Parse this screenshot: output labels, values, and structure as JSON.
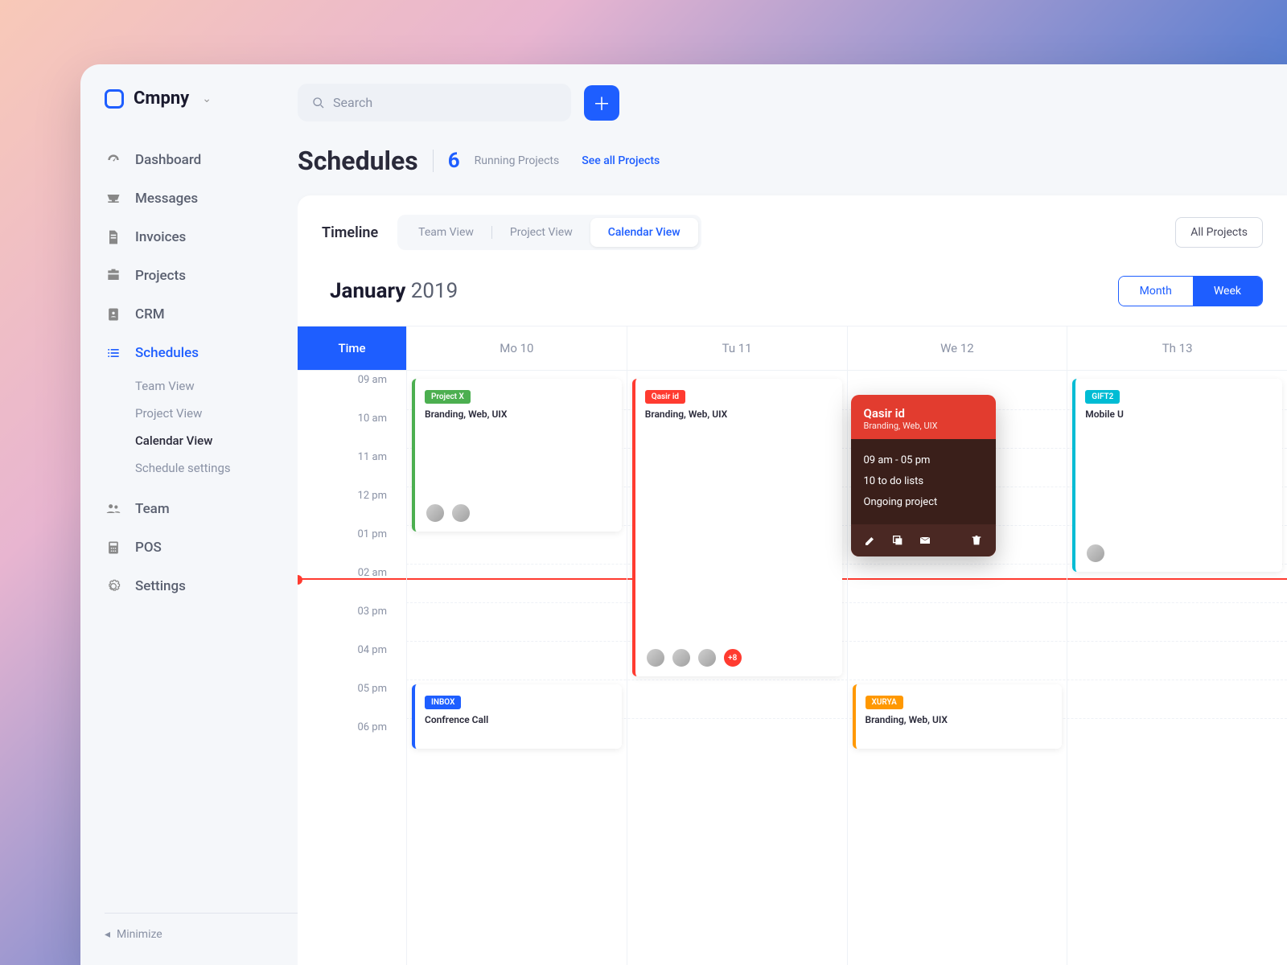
{
  "brand": "Cmpny",
  "search": {
    "placeholder": "Search"
  },
  "sidebar": {
    "items": [
      {
        "label": "Dashboard"
      },
      {
        "label": "Messages"
      },
      {
        "label": "Invoices"
      },
      {
        "label": "Projects"
      },
      {
        "label": "CRM"
      },
      {
        "label": "Schedules"
      },
      {
        "label": "Team"
      },
      {
        "label": "POS"
      },
      {
        "label": "Settings"
      }
    ],
    "sub": [
      {
        "label": "Team View"
      },
      {
        "label": "Project View"
      },
      {
        "label": "Calendar View"
      },
      {
        "label": "Schedule settings"
      }
    ],
    "minimize": "Minimize"
  },
  "header": {
    "title": "Schedules",
    "count": "6",
    "count_label": "Running Projects",
    "see_all": "See all Projects"
  },
  "panel": {
    "title": "Timeline",
    "tabs": [
      "Team View",
      "Project View",
      "Calendar View"
    ],
    "filter": "All Projects",
    "month": "January",
    "year": "2019",
    "range": [
      "Month",
      "Week"
    ]
  },
  "calendar": {
    "time_header": "Time",
    "days": [
      "Mo 10",
      "Tu 11",
      "We 12",
      "Th 13"
    ],
    "hours": [
      "09 am",
      "10 am",
      "11 am",
      "12 pm",
      "01 pm",
      "02 am",
      "03 pm",
      "04 pm",
      "05 pm",
      "06 pm"
    ]
  },
  "events": {
    "e1": {
      "tag": "Project X",
      "sub": "Branding, Web, UIX",
      "color": "#4caf50"
    },
    "e2": {
      "tag": "Qasir id",
      "sub": "Branding, Web, UIX",
      "color": "#ff3b30",
      "more": "+8"
    },
    "e3": {
      "tag": "GIFT2",
      "sub": "Mobile U",
      "color": "#00bcd4"
    },
    "e4": {
      "tag": "INBOX",
      "sub": "Confrence Call",
      "color": "#1e5eff"
    },
    "e5": {
      "tag": "XURYA",
      "sub": "Branding, Web, UIX",
      "color": "#ff9800"
    }
  },
  "popup": {
    "title": "Qasir id",
    "sub": "Branding, Web, UIX",
    "time": "09 am - 05 pm",
    "todos": "10 to do lists",
    "status": "Ongoing project"
  }
}
